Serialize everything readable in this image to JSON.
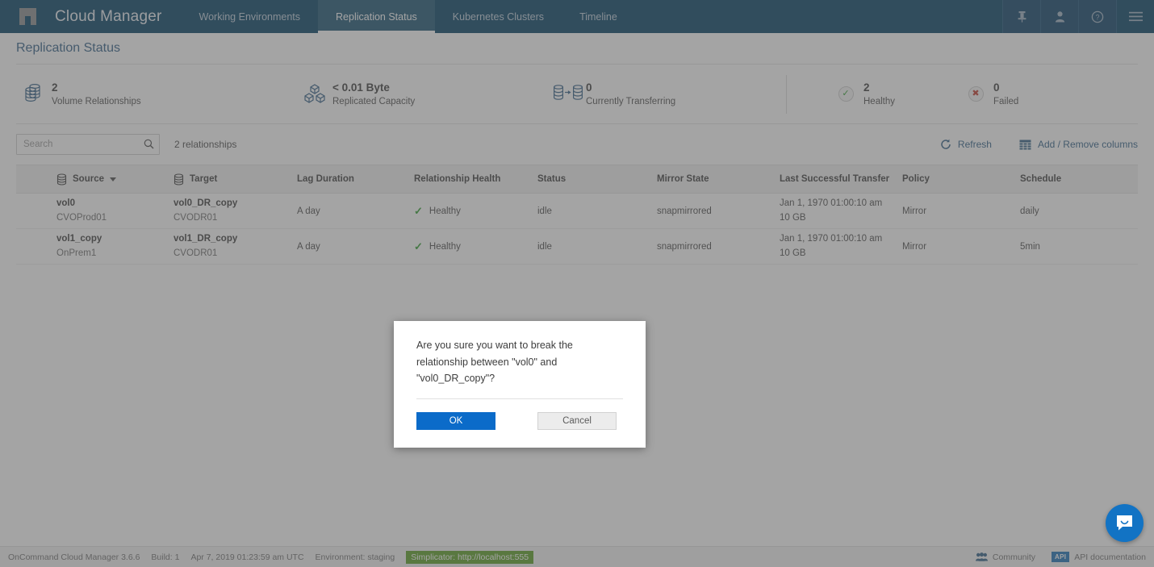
{
  "topnav": {
    "logo_name": "netapp-logo",
    "brand": "Cloud Manager",
    "items": [
      {
        "label": "Working Environments",
        "active": false
      },
      {
        "label": "Replication Status",
        "active": true
      },
      {
        "label": "Kubernetes Clusters",
        "active": false
      },
      {
        "label": "Timeline",
        "active": false
      }
    ],
    "icons": [
      "pin-icon",
      "user-icon",
      "help-icon",
      "hamburger-menu-icon"
    ]
  },
  "page": {
    "title": "Replication Status"
  },
  "stats": [
    {
      "icon": "volumes-stack-icon",
      "value": "2",
      "label": "Volume Relationships"
    },
    {
      "icon": "replicated-capacity-icon",
      "value": "< 0.01 Byte",
      "label": "Replicated Capacity"
    },
    {
      "icon": "transferring-icon",
      "value": "0",
      "label": "Currently Transferring"
    },
    {
      "icon": "healthy-check-icon",
      "value": "2",
      "label": "Healthy"
    },
    {
      "icon": "failed-x-icon",
      "value": "0",
      "label": "Failed"
    }
  ],
  "toolbar": {
    "search_placeholder": "Search",
    "search_value": "",
    "relationship_count": "2 relationships",
    "refresh_label": "Refresh",
    "columns_label": "Add / Remove columns"
  },
  "table": {
    "columns": [
      "Source",
      "Target",
      "Lag Duration",
      "Relationship Health",
      "Status",
      "Mirror State",
      "Last Successful Transfer",
      "Policy",
      "Schedule"
    ],
    "rows": [
      {
        "source_name": "vol0",
        "source_sub": "CVOProd01",
        "target_name": "vol0_DR_copy",
        "target_sub": "CVODR01",
        "lag": "A day",
        "health": "Healthy",
        "status": "idle",
        "mirror_state": "snapmirrored",
        "last_transfer": "Jan 1, 1970 01:00:10 am",
        "last_transfer_size": "10 GB",
        "policy": "Mirror",
        "schedule": "daily"
      },
      {
        "source_name": "vol1_copy",
        "source_sub": "OnPrem1",
        "target_name": "vol1_DR_copy",
        "target_sub": "CVODR01",
        "lag": "A day",
        "health": "Healthy",
        "status": "idle",
        "mirror_state": "snapmirrored",
        "last_transfer": "Jan 1, 1970 01:00:10 am",
        "last_transfer_size": "10 GB",
        "policy": "Mirror",
        "schedule": "5min"
      }
    ]
  },
  "modal": {
    "message": "Are you sure you want to break the relationship between \"vol0\" and \"vol0_DR_copy\"?",
    "ok_label": "OK",
    "cancel_label": "Cancel"
  },
  "footer": {
    "product": "OnCommand Cloud Manager 3.6.6",
    "build": "Build: 1",
    "timestamp": "Apr 7, 2019 01:23:59 am UTC",
    "environment": "Environment: staging",
    "simplicator_badge": "Simplicator: http://localhost:555",
    "community_label": "Community",
    "api_label": "API documentation",
    "api_badge": "API"
  },
  "colors": {
    "nav_bg": "#013f63",
    "accent_blue": "#0b6bc9",
    "title_blue": "#2f5d86",
    "healthy_green": "#2f9e2f",
    "failed_red": "#c0392b",
    "badge_green": "#5a9e22"
  }
}
